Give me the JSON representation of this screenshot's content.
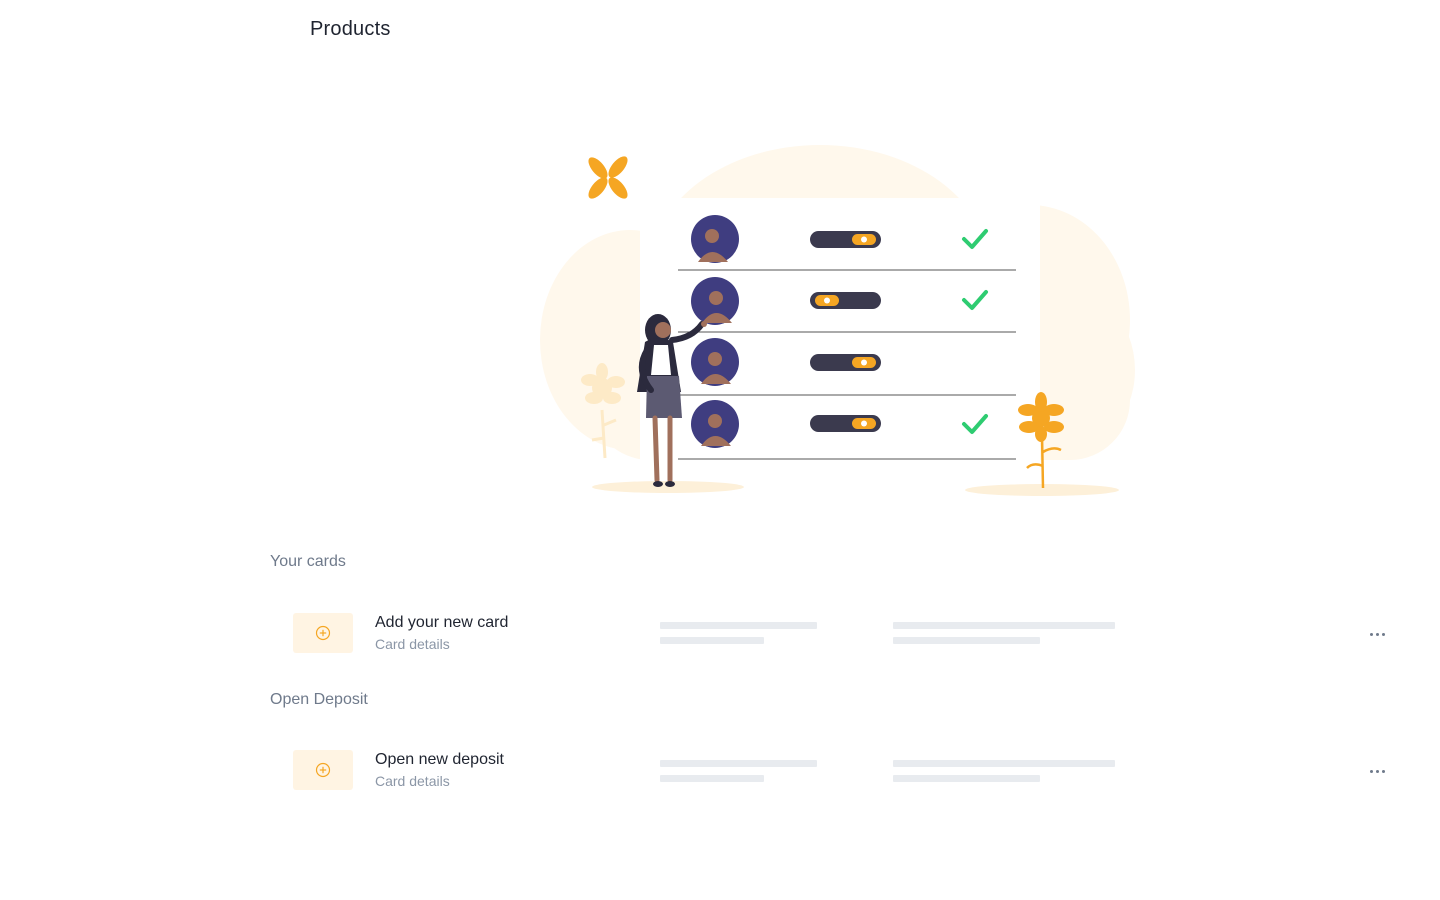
{
  "page": {
    "title": "Products"
  },
  "illustration": {
    "name": "people-checklist-illustration"
  },
  "sections": {
    "cards": {
      "title": "Your cards",
      "item": {
        "title": "Add your new card",
        "subtitle": "Card details",
        "icon": "plus-circle-icon"
      }
    },
    "deposit": {
      "title": "Open Deposit",
      "item": {
        "title": "Open new deposit",
        "subtitle": "Card details",
        "icon": "plus-circle-icon"
      }
    }
  },
  "colors": {
    "accent": "#f5a623",
    "accent_bg": "#fff4e3",
    "check": "#2ecc71",
    "avatar": "#3f3d80",
    "toggle": "#3b3a4e",
    "muted_text": "#8b96a6",
    "section_text": "#6f7a8b",
    "skeleton": "#e8ebef"
  }
}
